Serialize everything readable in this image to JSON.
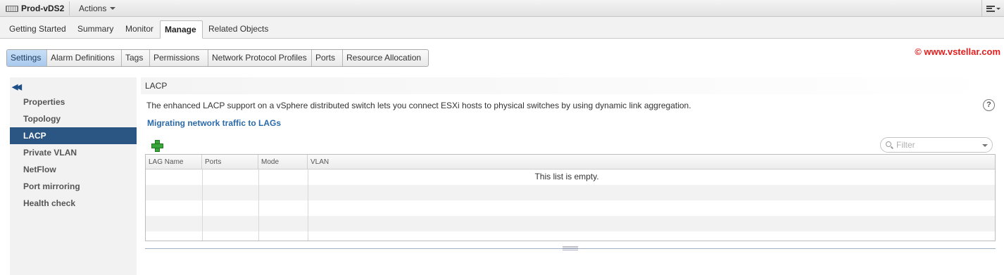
{
  "titlebar": {
    "object_name": "Prod-vDS2",
    "object_icon": "distributed-switch-icon",
    "actions_label": "Actions",
    "menu_icon": "menu-icon"
  },
  "main_tabs": [
    {
      "label": "Getting Started"
    },
    {
      "label": "Summary"
    },
    {
      "label": "Monitor"
    },
    {
      "label": "Manage",
      "active": true
    },
    {
      "label": "Related Objects"
    }
  ],
  "sub_tabs": [
    {
      "label": "Settings",
      "active": true
    },
    {
      "label": "Alarm Definitions"
    },
    {
      "label": "Tags"
    },
    {
      "label": "Permissions"
    },
    {
      "label": "Network Protocol Profiles"
    },
    {
      "label": "Ports"
    },
    {
      "label": "Resource Allocation"
    }
  ],
  "watermark": "© www.vstellar.com",
  "watermark_color": "#e41c1c",
  "left_nav": {
    "collapse_icon": "double-chevron-left-icon",
    "items": [
      {
        "label": "Properties"
      },
      {
        "label": "Topology"
      },
      {
        "label": "LACP",
        "active": true
      },
      {
        "label": "Private VLAN"
      },
      {
        "label": "NetFlow"
      },
      {
        "label": "Port mirroring"
      },
      {
        "label": "Health check"
      }
    ],
    "active_color": "#2b5582"
  },
  "section": {
    "title": "LACP",
    "description": "The enhanced LACP support on a vSphere distributed switch lets you connect ESXi hosts to physical switches by using dynamic link aggregation.",
    "help_icon": "?",
    "link": "Migrating network traffic to LAGs",
    "link_color": "#2a6aa8",
    "add_icon": "add-plus-icon"
  },
  "filter": {
    "placeholder": "Filter",
    "value": ""
  },
  "grid": {
    "columns": [
      "LAG Name",
      "Ports",
      "Mode",
      "VLAN"
    ],
    "rows": [],
    "empty_message": "This list is empty."
  }
}
